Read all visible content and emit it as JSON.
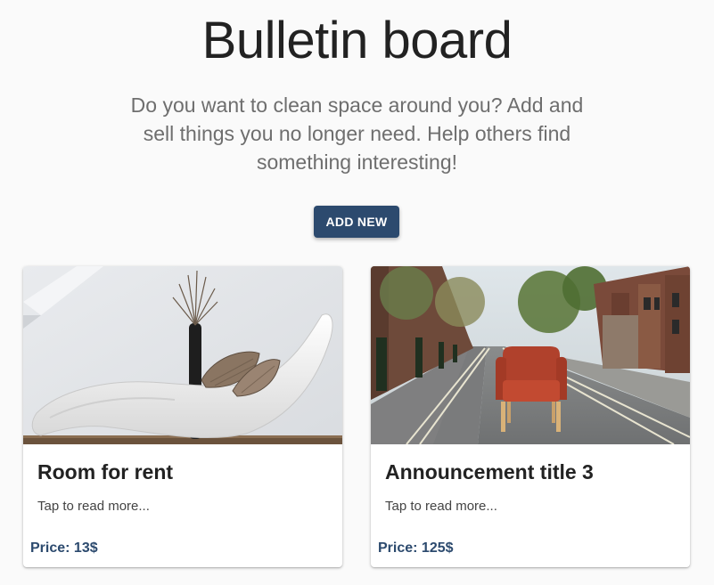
{
  "header": {
    "title": "Bulletin board",
    "subtitle": "Do you want to clean space around you? Add and sell things you no longer need. Help others find something interesting!",
    "add_button_label": "ADD NEW"
  },
  "cards": [
    {
      "title": "Room for rent",
      "description": "Tap to read more...",
      "price_label": "Price: 13$",
      "image": "white-chaise-lounge-photo"
    },
    {
      "title": "Announcement title 3",
      "description": "Tap to read more...",
      "price_label": "Price: 125$",
      "image": "red-armchair-on-street-photo"
    }
  ],
  "colors": {
    "accent": "#2c4a6e",
    "background": "#fafafa",
    "card": "#ffffff"
  }
}
